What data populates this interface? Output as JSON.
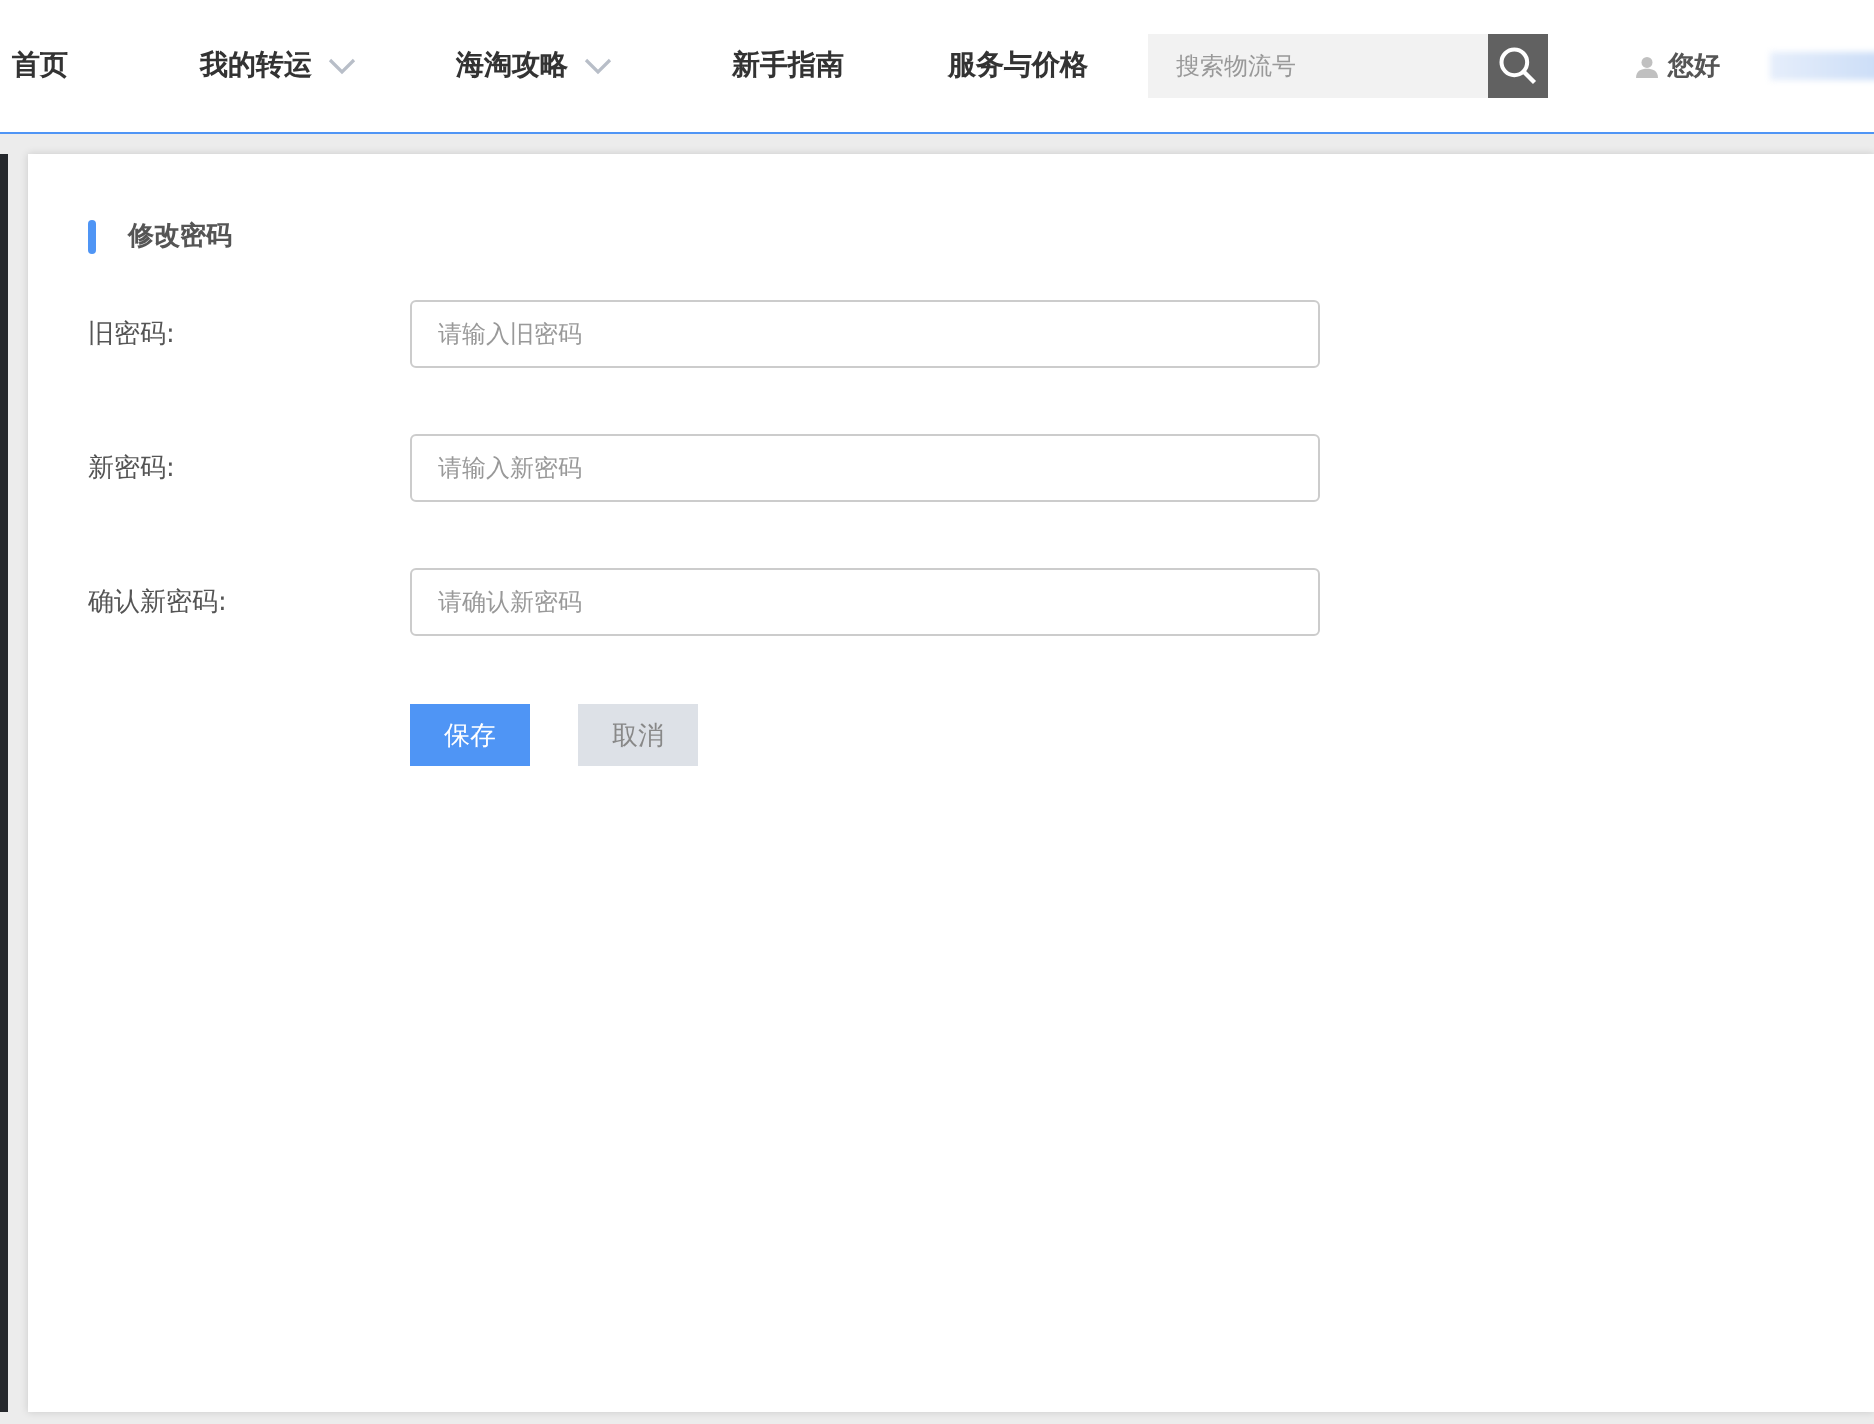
{
  "nav": {
    "items": [
      {
        "label": "首页",
        "has_menu": false
      },
      {
        "label": "我的转运",
        "has_menu": true
      },
      {
        "label": "海淘攻略",
        "has_menu": true
      },
      {
        "label": "新手指南",
        "has_menu": false
      },
      {
        "label": "服务与价格",
        "has_menu": false
      }
    ],
    "search": {
      "placeholder": "搜索物流号"
    },
    "greeting": "您好"
  },
  "form": {
    "title": "修改密码",
    "fields": [
      {
        "label": "旧密码:",
        "placeholder": "请输入旧密码"
      },
      {
        "label": "新密码:",
        "placeholder": "请输入新密码"
      },
      {
        "label": "确认新密码:",
        "placeholder": "请确认新密码"
      }
    ],
    "buttons": [
      {
        "label": "保存",
        "kind": "primary"
      },
      {
        "label": "取消",
        "kind": "secondary"
      }
    ]
  }
}
